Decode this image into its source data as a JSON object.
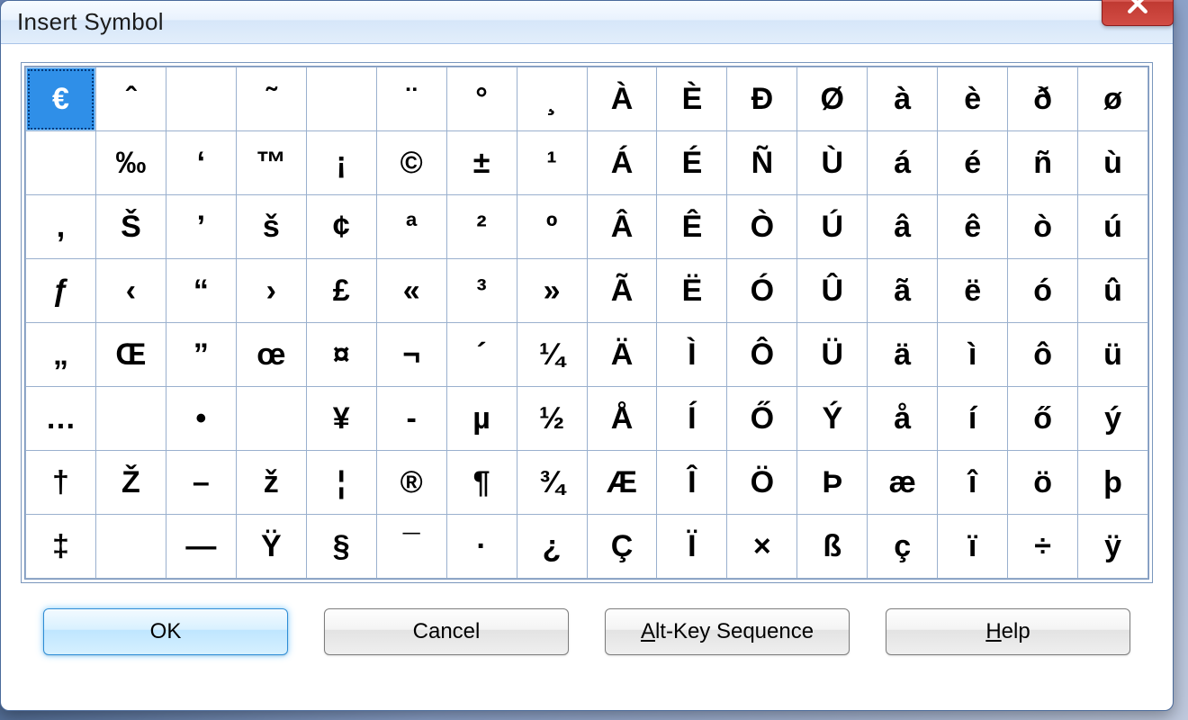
{
  "window": {
    "title": "Insert Symbol"
  },
  "buttons": {
    "ok": "OK",
    "cancel": "Cancel",
    "alt1": "A",
    "alt2": "lt-Key Sequence",
    "help1": "H",
    "help2": "elp"
  },
  "selected_symbol_index": 0,
  "grid": {
    "rows": 8,
    "cols": 16,
    "cells": [
      [
        "€",
        "ˆ",
        "",
        "˜",
        "",
        "¨",
        "°",
        "¸",
        "À",
        "È",
        "Ð",
        "Ø",
        "à",
        "è",
        "ð",
        "ø"
      ],
      [
        "",
        "‰",
        "‘",
        "™",
        "¡",
        "©",
        "±",
        "¹",
        "Á",
        "É",
        "Ñ",
        "Ù",
        "á",
        "é",
        "ñ",
        "ù"
      ],
      [
        ",",
        "Š",
        "’",
        "š",
        "¢",
        "ª",
        "²",
        "º",
        "Â",
        "Ê",
        "Ò",
        "Ú",
        "â",
        "ê",
        "ò",
        "ú"
      ],
      [
        "ƒ",
        "‹",
        "“",
        "›",
        "£",
        "«",
        "³",
        "»",
        "Ã",
        "Ë",
        "Ó",
        "Û",
        "ã",
        "ë",
        "ó",
        "û"
      ],
      [
        "„",
        "Œ",
        "”",
        "œ",
        "¤",
        "¬",
        "´",
        "¼",
        "Ä",
        "Ì",
        "Ô",
        "Ü",
        "ä",
        "ì",
        "ô",
        "ü"
      ],
      [
        "…",
        "",
        "•",
        "",
        "¥",
        "-",
        "µ",
        "½",
        "Å",
        "Í",
        "Ő",
        "Ý",
        "å",
        "í",
        "ő",
        "ý"
      ],
      [
        "†",
        "Ž",
        "–",
        "ž",
        "¦",
        "®",
        "¶",
        "¾",
        "Æ",
        "Î",
        "Ö",
        "Þ",
        "æ",
        "î",
        "ö",
        "þ"
      ],
      [
        "‡",
        "",
        "—",
        "Ÿ",
        "§",
        "¯",
        "·",
        "¿",
        "Ç",
        "Ï",
        "×",
        "ß",
        "ç",
        "ï",
        "÷",
        "ÿ"
      ]
    ]
  }
}
